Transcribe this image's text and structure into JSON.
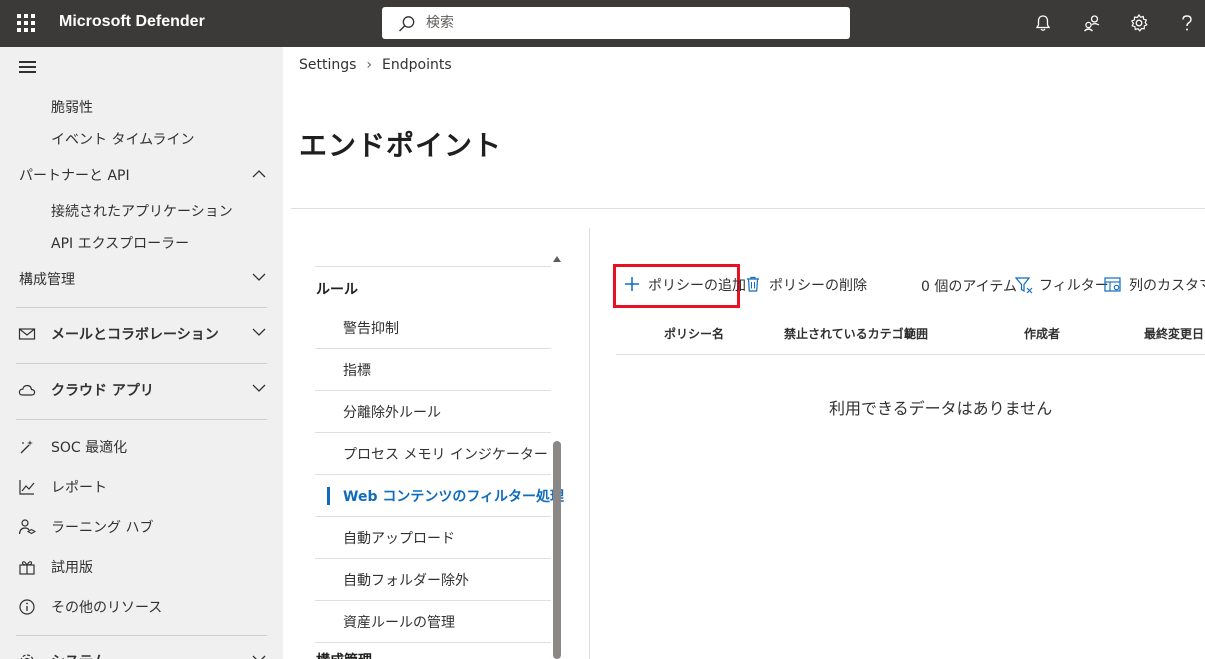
{
  "app": {
    "title": "Microsoft Defender"
  },
  "search": {
    "placeholder": "検索"
  },
  "nav": {
    "items": [
      {
        "label": "脆弱性"
      },
      {
        "label": "イベント タイムライン"
      },
      {
        "label": "パートナーと API"
      },
      {
        "label": "接続されたアプリケーション"
      },
      {
        "label": "API エクスプローラー"
      },
      {
        "label": "構成管理"
      },
      {
        "label": "メールとコラボレーション"
      },
      {
        "label": "クラウド アプリ"
      },
      {
        "label": "SOC 最適化"
      },
      {
        "label": "レポート"
      },
      {
        "label": "ラーニング ハブ"
      },
      {
        "label": "試用版"
      },
      {
        "label": "その他のリソース"
      },
      {
        "label": "システム"
      }
    ]
  },
  "breadcrumb": {
    "items": [
      "Settings",
      "Endpoints"
    ]
  },
  "page": {
    "title": "エンドポイント"
  },
  "rules": {
    "heading": "ルール",
    "items": [
      {
        "label": "警告抑制"
      },
      {
        "label": "指標"
      },
      {
        "label": "分離除外ルール"
      },
      {
        "label": "プロセス メモリ インジケーター"
      },
      {
        "label": "Web コンテンツのフィルター処理",
        "active": true
      },
      {
        "label": "自動アップロード"
      },
      {
        "label": "自動フォルダー除外"
      },
      {
        "label": "資産ルールの管理"
      }
    ],
    "next_heading": "構成管理"
  },
  "toolbar": {
    "add_policy": "ポリシーの追加",
    "delete_policy": "ポリシーの削除",
    "item_count": "0 個のアイテム",
    "filter": "フィルター",
    "customize_columns": "列のカスタマイズ"
  },
  "table": {
    "columns": [
      "ポリシー名",
      "禁止されているカテゴリ",
      "範囲",
      "作成者",
      "最終変更日"
    ],
    "empty_message": "利用できるデータはありません"
  },
  "colors": {
    "accent": "#0f6cbd",
    "highlight": "#e81123",
    "topbar": "#3b3a39",
    "nav_bg": "#f0f0f0"
  }
}
